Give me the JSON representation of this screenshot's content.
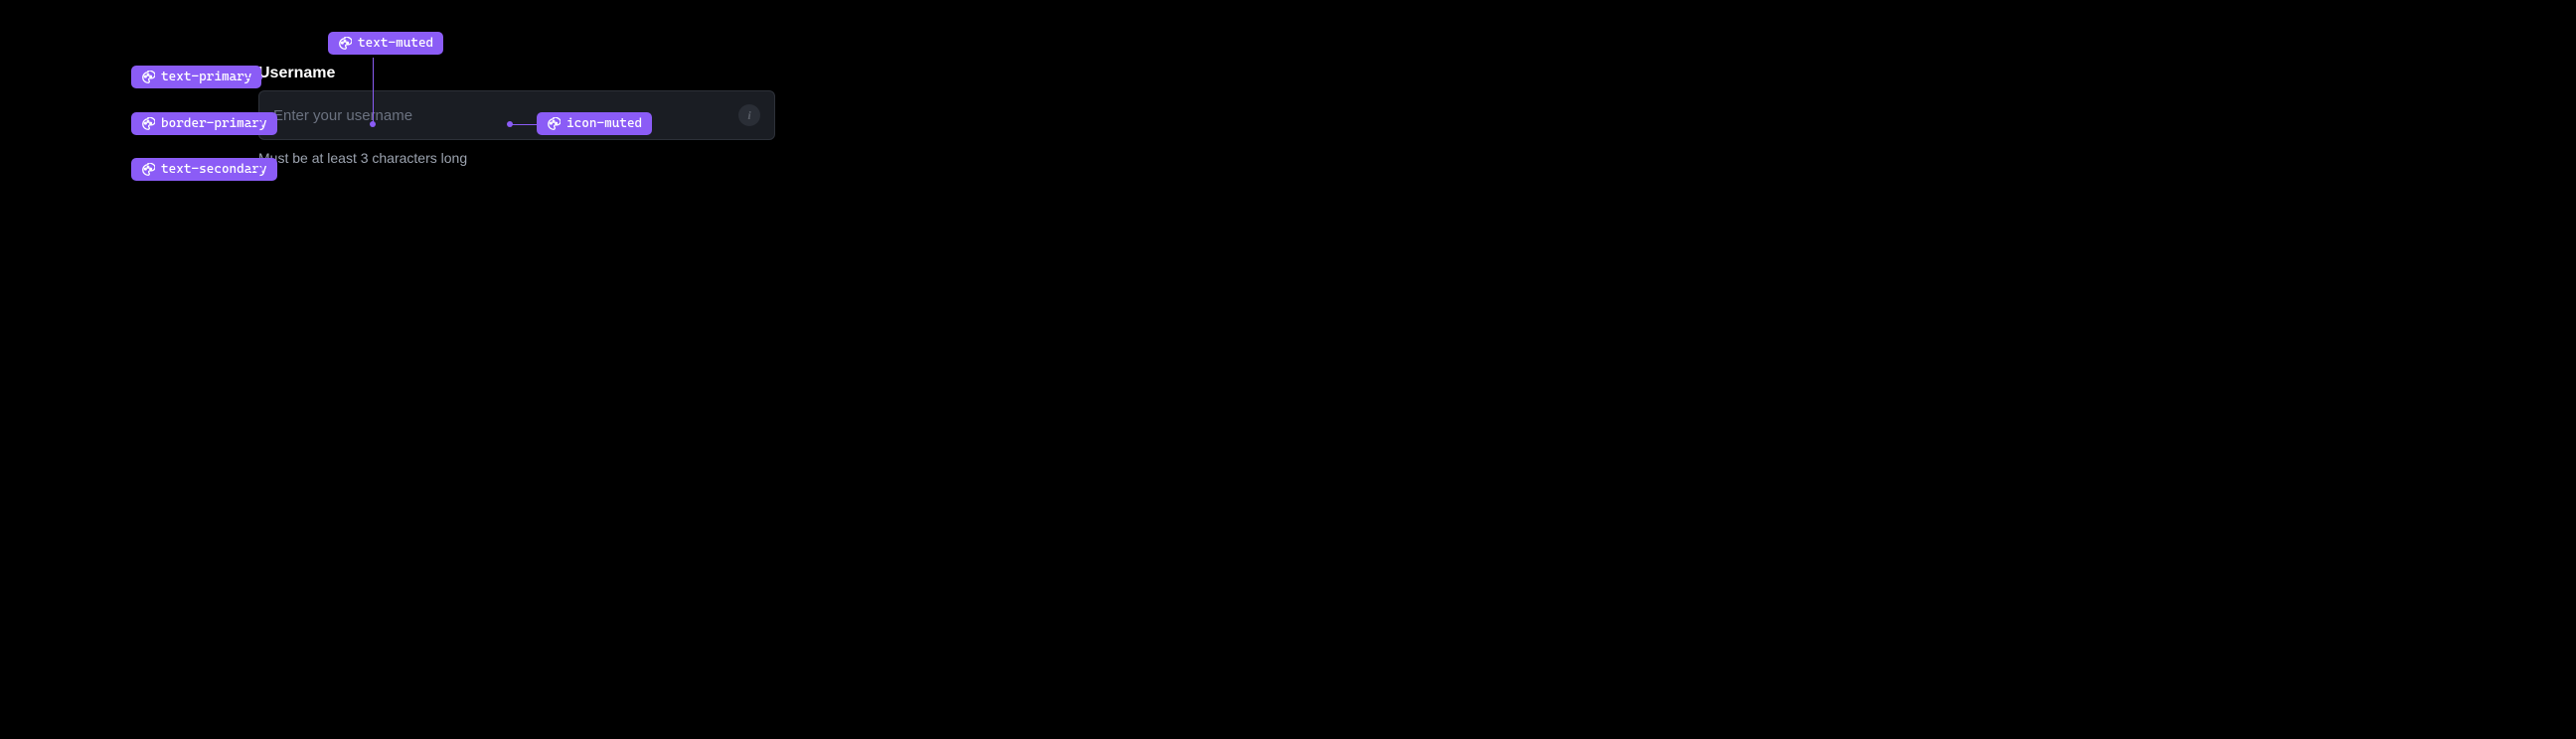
{
  "field": {
    "label": "Username",
    "placeholder": "Enter your username",
    "helper": "Must be at least 3 characters long",
    "info_icon_glyph": "i"
  },
  "annotations": {
    "text_primary": "text-primary",
    "border_primary": "border-primary",
    "text_secondary": "text-secondary",
    "text_muted": "text-muted",
    "icon_muted": "icon-muted"
  },
  "colors": {
    "annotation_bg": "#8b5cf6",
    "input_bg": "#1a1d23",
    "border": "#2d3139",
    "text_primary": "#ffffff",
    "text_secondary": "#9ca3af",
    "text_muted": "#6b7280",
    "icon_muted": "#5a5f68"
  }
}
